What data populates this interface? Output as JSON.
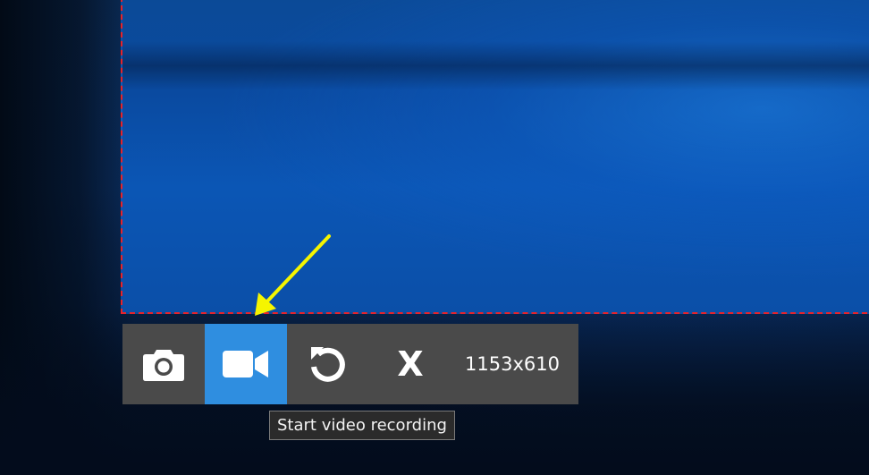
{
  "toolbar": {
    "screenshot_button": {
      "icon": "camera-icon"
    },
    "video_button": {
      "icon": "video-camera-icon",
      "active": true
    },
    "reset_button": {
      "icon": "undo-icon"
    },
    "close_button": {
      "label": "X"
    },
    "selection_size": "1153x610"
  },
  "tooltip": {
    "text": "Start video recording"
  },
  "colors": {
    "selection_border": "#e8232a",
    "toolbar_bg": "#4a4a4a",
    "active_button": "#2f8ee0",
    "arrow": "#f5f500",
    "tooltip_bg": "#2b2b2b"
  }
}
